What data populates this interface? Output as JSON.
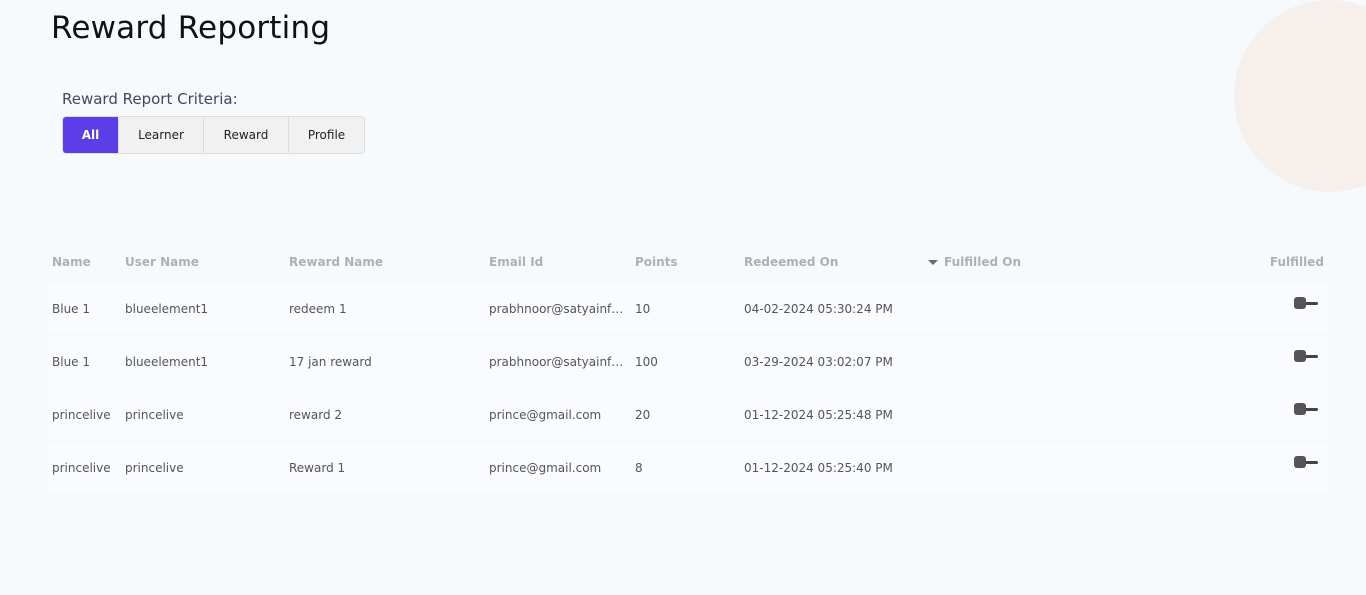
{
  "page": {
    "title": "Reward Reporting"
  },
  "criteria": {
    "label": "Reward Report Criteria:",
    "tabs": [
      {
        "label": "All",
        "active": true
      },
      {
        "label": "Learner",
        "active": false
      },
      {
        "label": "Reward",
        "active": false
      },
      {
        "label": "Profile",
        "active": false
      }
    ]
  },
  "table": {
    "headers": {
      "name": "Name",
      "user_name": "User Name",
      "reward_name": "Reward Name",
      "email": "Email Id",
      "points": "Points",
      "redeemed_on": "Redeemed On",
      "fulfilled_on": "Fulfilled On",
      "fulfilled": "Fulfilled"
    },
    "sort_icon": "caret-down-icon",
    "rows": [
      {
        "name": "Blue 1",
        "user_name": "blueelement1",
        "reward_name": "redeem 1",
        "email": "prabhnoor@satyainfo…",
        "points": "10",
        "redeemed_on": "04-02-2024 05:30:24 PM",
        "fulfilled_on": "",
        "fulfilled": false
      },
      {
        "name": "Blue 1",
        "user_name": "blueelement1",
        "reward_name": "17 jan reward",
        "email": "prabhnoor@satyainfo…",
        "points": "100",
        "redeemed_on": "03-29-2024 03:02:07 PM",
        "fulfilled_on": "",
        "fulfilled": false
      },
      {
        "name": "princelive",
        "user_name": "princelive",
        "reward_name": "reward 2",
        "email": "prince@gmail.com",
        "points": "20",
        "redeemed_on": "01-12-2024 05:25:48 PM",
        "fulfilled_on": "",
        "fulfilled": false
      },
      {
        "name": "princelive",
        "user_name": "princelive",
        "reward_name": "Reward 1",
        "email": "prince@gmail.com",
        "points": "8",
        "redeemed_on": "01-12-2024 05:25:40 PM",
        "fulfilled_on": "",
        "fulfilled": false
      }
    ]
  },
  "colors": {
    "accent": "#5b3ee8",
    "background": "#f7fafd",
    "decor_circle": "#f6efec",
    "header_text": "#b0b0b0"
  }
}
